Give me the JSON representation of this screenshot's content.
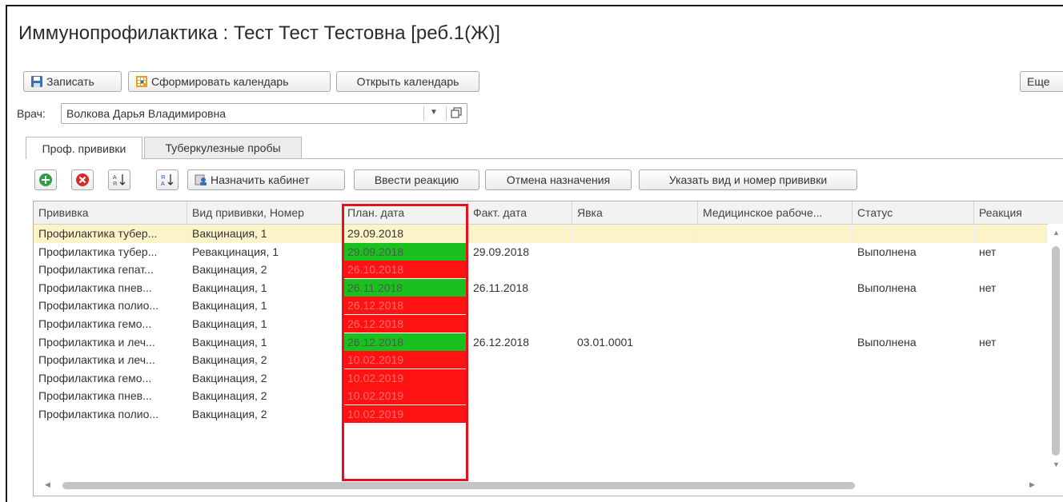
{
  "window": {
    "title": "Иммунопрофилактика : Тест Тест Тестовна [реб.1(Ж)]"
  },
  "toolbar": {
    "save_label": "Записать",
    "build_calendar_label": "Сформировать календарь",
    "open_calendar_label": "Открыть календарь",
    "more_label": "Еще"
  },
  "doctor": {
    "label": "Врач:",
    "value": "Волкова Дарья Владимировна"
  },
  "tabs": [
    {
      "label": "Проф. прививки",
      "active": true
    },
    {
      "label": "Туберкулезные пробы",
      "active": false
    }
  ],
  "grid_toolbar": {
    "assign_cabinet_label": "Назначить кабинет",
    "enter_reaction_label": "Ввести реакцию",
    "cancel_assignment_label": "Отмена назначения",
    "specify_type_label": "Указать вид и номер прививки"
  },
  "columns": [
    "Прививка",
    "Вид прививки, Номер",
    "План. дата",
    "Факт. дата",
    "Явка",
    "Медицинское рабоче...",
    "Статус",
    "Реакция"
  ],
  "colors": {
    "done": "#19c11e",
    "overdue": "#ff1212",
    "selected_row": "#fdf3c9",
    "highlight_frame": "#e8101a"
  },
  "rows": [
    {
      "vaccine": "Профилактика тубер...",
      "kind": "Вакцинация, 1",
      "plan": "29.09.2018",
      "plan_status": "none",
      "fact": "",
      "visit": "",
      "workplace": "",
      "status": "",
      "reaction": "",
      "selected": true
    },
    {
      "vaccine": "Профилактика тубер...",
      "kind": "Ревакцинация, 1",
      "plan": "29.09.2018",
      "plan_status": "done",
      "fact": "29.09.2018",
      "visit": "",
      "workplace": "",
      "status": "Выполнена",
      "reaction": "нет",
      "selected": false
    },
    {
      "vaccine": "Профилактика гепат...",
      "kind": "Вакцинация, 2",
      "plan": "26.10.2018",
      "plan_status": "overdue",
      "fact": "",
      "visit": "",
      "workplace": "",
      "status": "",
      "reaction": "",
      "selected": false
    },
    {
      "vaccine": "Профилактика пнев...",
      "kind": "Вакцинация, 1",
      "plan": "26.11.2018",
      "plan_status": "done",
      "fact": "26.11.2018",
      "visit": "",
      "workplace": "",
      "status": "Выполнена",
      "reaction": "нет",
      "selected": false
    },
    {
      "vaccine": "Профилактика полио...",
      "kind": "Вакцинация, 1",
      "plan": "26.12.2018",
      "plan_status": "overdue",
      "fact": "",
      "visit": "",
      "workplace": "",
      "status": "",
      "reaction": "",
      "selected": false
    },
    {
      "vaccine": "Профилактика гемо...",
      "kind": "Вакцинация, 1",
      "plan": "26.12.2018",
      "plan_status": "overdue",
      "fact": "",
      "visit": "",
      "workplace": "",
      "status": "",
      "reaction": "",
      "selected": false
    },
    {
      "vaccine": "Профилактика и леч...",
      "kind": "Вакцинация, 1",
      "plan": "26.12.2018",
      "plan_status": "done",
      "fact": "26.12.2018",
      "visit": "03.01.0001",
      "workplace": "",
      "status": "Выполнена",
      "reaction": "нет",
      "selected": false
    },
    {
      "vaccine": "Профилактика и леч...",
      "kind": "Вакцинация, 2",
      "plan": "10.02.2019",
      "plan_status": "overdue",
      "fact": "",
      "visit": "",
      "workplace": "",
      "status": "",
      "reaction": "",
      "selected": false
    },
    {
      "vaccine": "Профилактика гемо...",
      "kind": "Вакцинация, 2",
      "plan": "10.02.2019",
      "plan_status": "overdue",
      "fact": "",
      "visit": "",
      "workplace": "",
      "status": "",
      "reaction": "",
      "selected": false
    },
    {
      "vaccine": "Профилактика пнев...",
      "kind": "Вакцинация, 2",
      "plan": "10.02.2019",
      "plan_status": "overdue",
      "fact": "",
      "visit": "",
      "workplace": "",
      "status": "",
      "reaction": "",
      "selected": false
    },
    {
      "vaccine": "Профилактика полио...",
      "kind": "Вакцинация, 2",
      "plan": "10.02.2019",
      "plan_status": "overdue",
      "fact": "",
      "visit": "",
      "workplace": "",
      "status": "",
      "reaction": "",
      "selected": false
    }
  ]
}
